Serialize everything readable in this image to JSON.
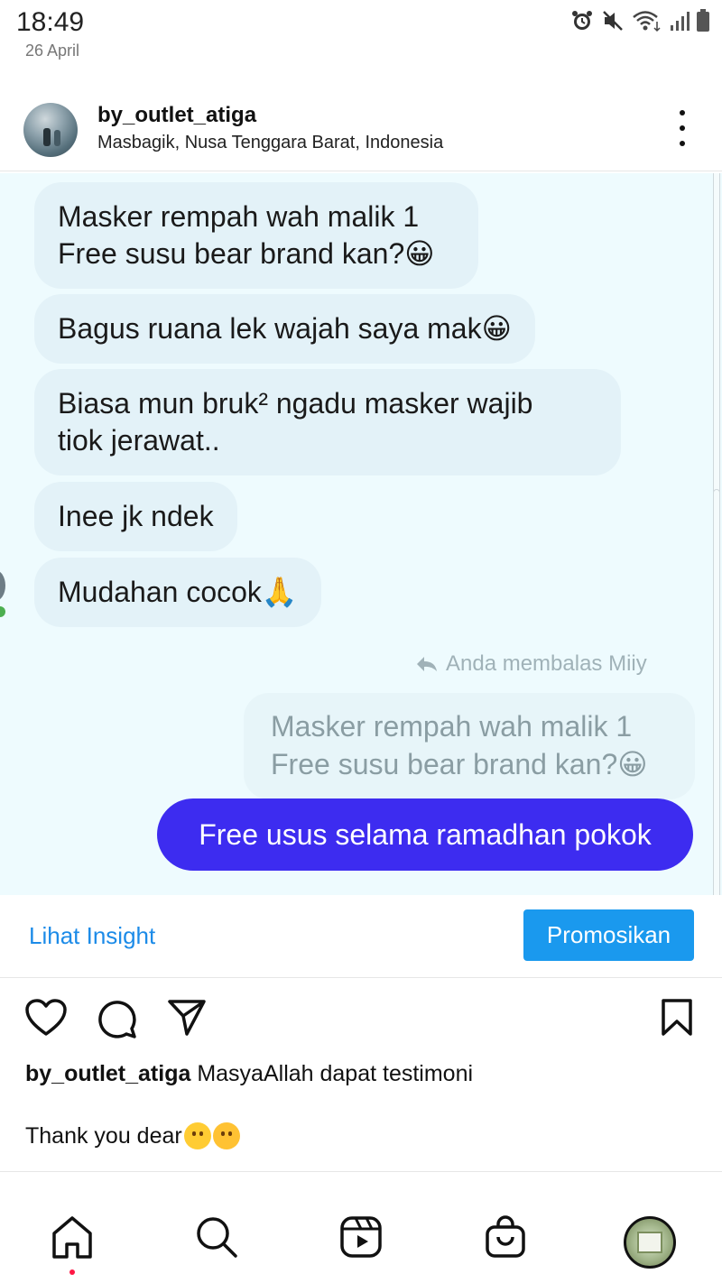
{
  "status_bar": {
    "time": "18:49",
    "date": "26 April",
    "icons": [
      "alarm-icon",
      "mute-icon",
      "wifi-icon",
      "signal-icon",
      "battery-icon"
    ]
  },
  "post": {
    "username": "by_outlet_atiga",
    "location": "Masbagik, Nusa Tenggara Barat, Indonesia"
  },
  "chat": {
    "incoming": [
      {
        "text": "Masker rempah wah malik 1\nFree susu bear brand kan?😀"
      },
      {
        "text": "Bagus ruana lek wajah saya mak😀"
      },
      {
        "text": "Biasa mun bruk² ngadu masker wajib\ntiok jerawat.."
      },
      {
        "text": "Inee jk ndek"
      },
      {
        "text": "Mudahan cocok🙏"
      }
    ],
    "reply_note": "Anda membalas Miiy",
    "quoted": "Masker rempah wah malik 1\nFree susu bear brand kan?😀",
    "outgoing": "Free usus selama ramadhan pokok"
  },
  "insight": {
    "link_label": "Lihat Insight",
    "promote_label": "Promosikan"
  },
  "caption": {
    "username": "by_outlet_atiga",
    "text": "MasyaAllah dapat testimoni",
    "line2": "Thank you dear"
  },
  "colors": {
    "outgoing_bubble": "#3d2cf0",
    "incoming_bubble": "#e3f2f8",
    "link_blue": "#1c8be8",
    "promote_blue": "#1a99ee"
  }
}
